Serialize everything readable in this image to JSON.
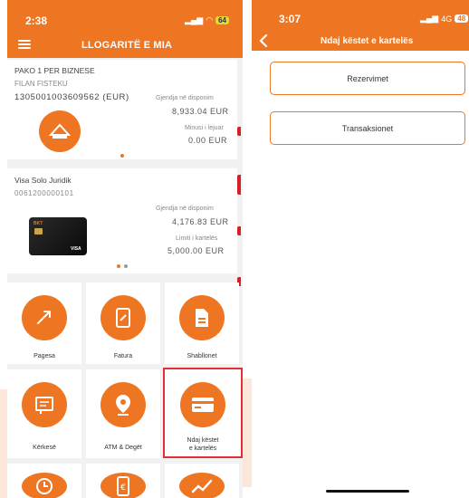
{
  "colors": {
    "brand_orange": "#ee7623",
    "highlight_red": "#e0313a"
  },
  "left_screen": {
    "status": {
      "time": "2:38",
      "signal_icon": "signal-icon",
      "wifi_icon": "wifi-icon",
      "battery": "64"
    },
    "header": {
      "title": "LLOGARITË E MIA",
      "menu_icon": "hamburger-icon"
    },
    "account": {
      "name": "PAKO 1 PER BIZNESE",
      "holder": "FILAN FISTEKU",
      "number": "1305001003609562 (EUR)",
      "available_label": "Gjendja në disponim",
      "available_value": "8,933.04 EUR",
      "overdraft_label": "Minusi i lejuar",
      "overdraft_value": "0.00 EUR",
      "icon": "piggy-bank-icon"
    },
    "card": {
      "name": "Visa Solo Juridik",
      "number": "0061200000101",
      "available_label": "Gjendja në disponim",
      "available_value": "4,176.83 EUR",
      "limit_label": "Limiti i kartelës",
      "limit_value": "5,000.00 EUR",
      "image_brand": "VISA",
      "image_bank": "BKT"
    },
    "tiles": [
      {
        "label": "Pagesa",
        "icon": "transfer-icon"
      },
      {
        "label": "Fatura",
        "icon": "invoice-icon"
      },
      {
        "label": "Shabllonet",
        "icon": "document-icon"
      },
      {
        "label": "Kërkesë",
        "icon": "request-icon"
      },
      {
        "label": "ATM & Degët",
        "icon": "location-pin-icon"
      },
      {
        "label_line1": "Ndaj këstet",
        "label_line2": "e kartelës",
        "icon": "credit-card-icon"
      }
    ]
  },
  "right_screen": {
    "status": {
      "time": "3:07",
      "network": "4G",
      "battery": "48"
    },
    "header": {
      "title": "Ndaj këstet e kartelës",
      "back_icon": "back-chevron-icon"
    },
    "buttons": [
      {
        "label": "Rezervimet"
      },
      {
        "label": "Transaksionet"
      }
    ]
  }
}
